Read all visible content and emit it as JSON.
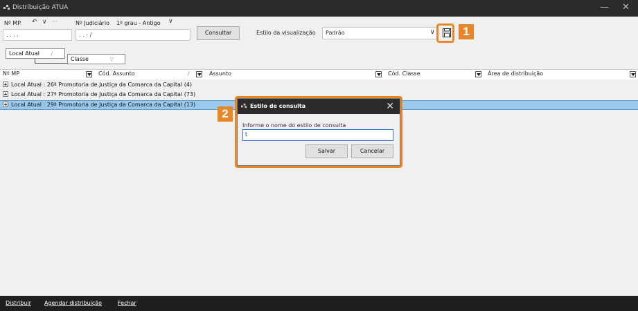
{
  "window": {
    "title": "Distribuição ATUA",
    "minimize_glyph": "—",
    "close_glyph": "✕"
  },
  "toolbar": {
    "nmp_label": "Nº MP",
    "undo_glyph": "↶",
    "chevron_glyph": "∨",
    "more_glyph": "···",
    "nmp_value": ". . . .",
    "judicial_label": "Nº Judiciário",
    "judicial_mode": "1º grau - Antigo",
    "judicial_value": ". . - /",
    "consultar_label": "Consultar",
    "style_label": "Estilo da visualização",
    "style_value": "Padrão",
    "save_icon_glyph": "🖫"
  },
  "grouping": {
    "chips": [
      "Local Atual",
      "Classe"
    ],
    "sort_glyph": "/",
    "filter_glyph": "▽"
  },
  "columns": [
    "Nº MP",
    "Cód. Assunto",
    "Assunto",
    "Cód. Classe",
    "Área de distribuição"
  ],
  "rows": [
    "Local Atual : 26ª Promotoria de Justiça da Comarca da Capital (4)",
    "Local Atual : 27ª Promotoria de Justiça da Comarca da Capital (73)",
    "Local Atual : 29ª Promotoria de Justiça da Comarca da Capital (13)"
  ],
  "dialog": {
    "title": "Estilo de consulta",
    "prompt": "Informe o nome do estilo de consulta",
    "input_value": "t",
    "save": "Salvar",
    "cancel": "Cancelar"
  },
  "callouts": {
    "one": "1",
    "two": "2"
  },
  "statusbar": {
    "distribuir": "Distribuir",
    "agendar": "Agendar distribuição",
    "fechar": "Fechar"
  },
  "colors": {
    "accent": "#e8862a",
    "selection": "#99c9ef",
    "titlebar": "#2b2b2b"
  }
}
